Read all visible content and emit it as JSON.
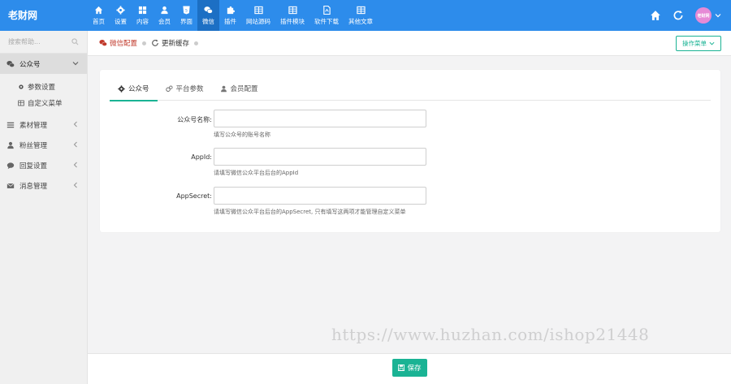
{
  "app": {
    "title": "老财网"
  },
  "nav": {
    "items": [
      {
        "label": "首页",
        "icon": "home-icon"
      },
      {
        "label": "设置",
        "icon": "gear-icon"
      },
      {
        "label": "内容",
        "icon": "grid-icon"
      },
      {
        "label": "会员",
        "icon": "user-icon"
      },
      {
        "label": "界面",
        "icon": "html5-icon"
      },
      {
        "label": "微信",
        "icon": "wechat-icon",
        "active": true
      },
      {
        "label": "插件",
        "icon": "puzzle-icon"
      },
      {
        "label": "网站源码",
        "icon": "table-icon"
      },
      {
        "label": "插件模块",
        "icon": "table-icon"
      },
      {
        "label": "软件下载",
        "icon": "file-icon"
      },
      {
        "label": "其他文章",
        "icon": "table-icon"
      }
    ]
  },
  "topright": {
    "avatar_text": "老财网"
  },
  "sidebar": {
    "search_placeholder": "搜索帮助...",
    "group_active": "公众号",
    "subitems": [
      "参数设置",
      "自定义菜单"
    ],
    "groups": [
      "素材管理",
      "粉丝管理",
      "回复设置",
      "消息管理"
    ]
  },
  "breadcrumb": {
    "active": "微信配置",
    "refresh": "更新缓存",
    "ops_label": "操作菜单"
  },
  "tabs": [
    "公众号",
    "平台参数",
    "会员配置"
  ],
  "form": {
    "fields": [
      {
        "label": "公众号名称:",
        "value": "",
        "help": "填写公众号的账号名称"
      },
      {
        "label": "AppId:",
        "value": "",
        "help": "请填写微信公众平台后台的AppId"
      },
      {
        "label": "AppSecret:",
        "value": "",
        "help": "请填写微信公众平台后台的AppSecret, 只有填写这两项才能管理自定义菜单"
      }
    ]
  },
  "footer": {
    "save_label": "保存"
  },
  "watermark": "https://www.huzhan.com/ishop21448",
  "colors": {
    "topbar": "#2d8ceb",
    "accent": "#1ab394",
    "active_crumb": "#c0392b"
  }
}
